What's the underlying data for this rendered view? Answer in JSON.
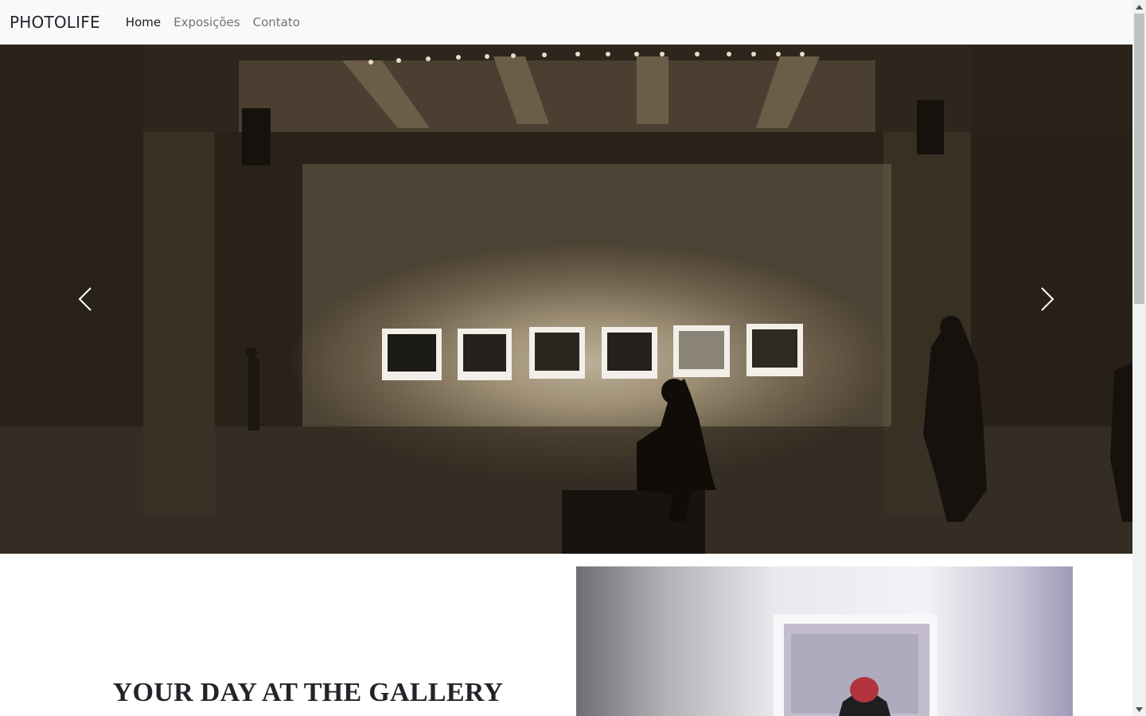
{
  "navbar": {
    "brand": "PHOTOLIFE",
    "links": [
      {
        "label": "Home",
        "active": true
      },
      {
        "label": "Exposições",
        "active": false
      },
      {
        "label": "Contato",
        "active": false
      }
    ]
  },
  "carousel": {
    "prev_icon": "chevron-left-icon",
    "next_icon": "chevron-right-icon"
  },
  "feature": {
    "title": "YOUR DAY AT THE GALLERY"
  },
  "colors": {
    "navbar_bg": "#f8f9fa",
    "text": "#212529"
  }
}
